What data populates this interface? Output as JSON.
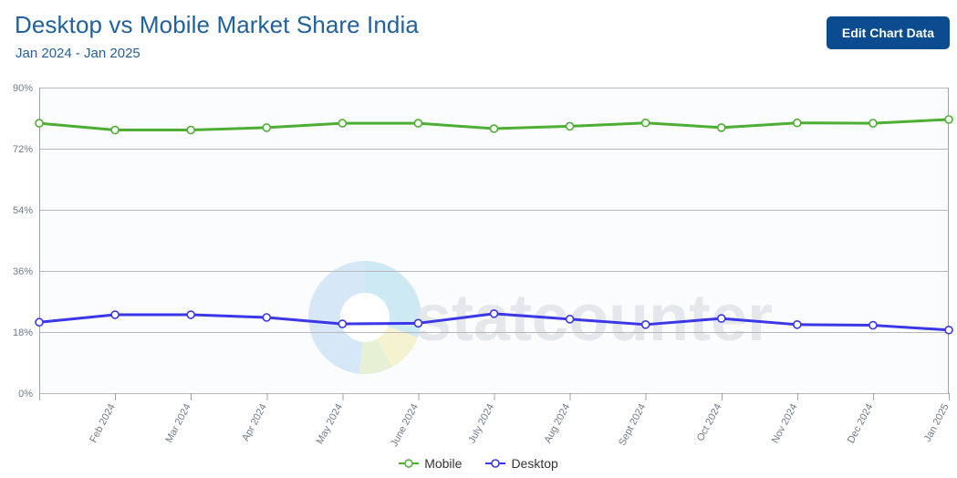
{
  "header": {
    "title": "Desktop vs Mobile Market Share India",
    "subtitle": "Jan 2024 - Jan 2025",
    "edit_button_label": "Edit Chart Data"
  },
  "watermark": {
    "text": "statcounter"
  },
  "colors": {
    "title": "#22619c",
    "button_bg": "#0b4b8f",
    "mobile": "#4caf34",
    "desktop": "#3b36e8",
    "grid": "#b7b7b7",
    "axis_text": "#707b8a"
  },
  "chart_data": {
    "type": "line",
    "title": "Desktop vs Mobile Market Share India",
    "subtitle": "Jan 2024 - Jan 2025",
    "xlabel": "",
    "ylabel": "",
    "ylim": [
      0,
      90
    ],
    "yticks": [
      0,
      18,
      36,
      54,
      72,
      90
    ],
    "ytick_labels": [
      "0%",
      "18%",
      "36%",
      "54%",
      "72%",
      "90%"
    ],
    "grid": true,
    "legend_position": "bottom",
    "categories": [
      "Jan 2024",
      "Feb 2024",
      "Mar 2024",
      "Apr 2024",
      "May 2024",
      "June 2024",
      "July 2024",
      "Aug 2024",
      "Sept 2024",
      "Oct 2024",
      "Nov 2024",
      "Dec 2024",
      "Jan 2025"
    ],
    "xtick_labels": [
      "",
      "Feb 2024",
      "Mar 2024",
      "Apr 2024",
      "May 2024",
      "June 2024",
      "July 2024",
      "Aug 2024",
      "Sept 2024",
      "Oct 2024",
      "Nov 2024",
      "Dec 2024",
      "Jan 2025"
    ],
    "series": [
      {
        "name": "Mobile",
        "color": "#4caf34",
        "values": [
          79.5,
          77.5,
          77.5,
          78.2,
          79.5,
          79.5,
          77.9,
          78.6,
          79.6,
          78.2,
          79.6,
          79.5,
          80.6
        ]
      },
      {
        "name": "Desktop",
        "color": "#3b36e8",
        "values": [
          20.9,
          23.1,
          23.1,
          22.3,
          20.4,
          20.6,
          23.4,
          21.8,
          20.2,
          22.0,
          20.2,
          20.0,
          18.6
        ]
      }
    ]
  }
}
